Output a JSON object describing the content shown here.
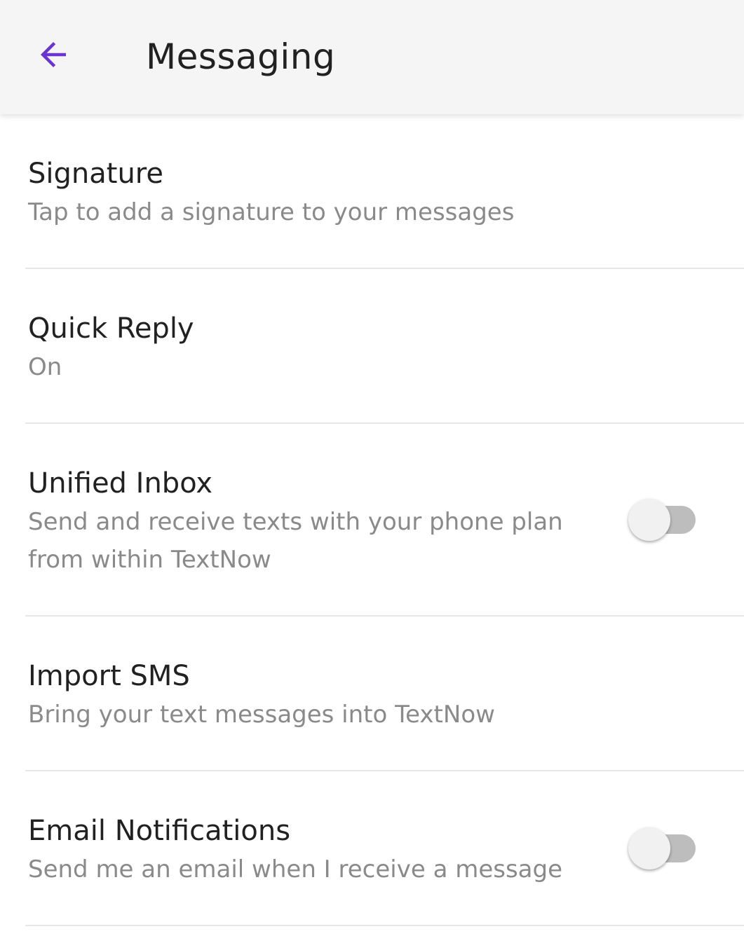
{
  "header": {
    "title": "Messaging",
    "back_icon": "arrow-left-icon",
    "accent_color": "#6a34d2"
  },
  "settings": [
    {
      "title": "Signature",
      "subtitle": "Tap to add a signature to your messages"
    },
    {
      "title": "Quick Reply",
      "subtitle": "On"
    },
    {
      "title": "Unified Inbox",
      "subtitle": "Send and receive texts with your phone plan from within TextNow",
      "toggle_on": false
    },
    {
      "title": "Import SMS",
      "subtitle": "Bring your text messages into TextNow"
    },
    {
      "title": "Email Notifications",
      "subtitle": "Send me an email when I receive a message",
      "toggle_on": false
    }
  ]
}
